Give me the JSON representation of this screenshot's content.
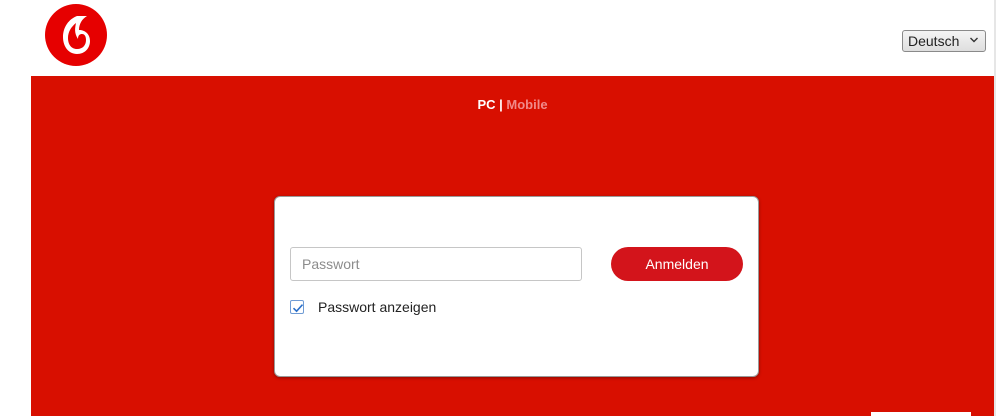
{
  "header": {
    "logo_icon": "vodafone-speechmark-logo",
    "language_select": {
      "selected": "Deutsch",
      "icon": "chevron-down-icon"
    }
  },
  "mode_switch": {
    "pc_label": "PC",
    "separator": "|",
    "mobile_label": "Mobile"
  },
  "login": {
    "password_placeholder": "Passwort",
    "password_value": "",
    "submit_label": "Anmelden",
    "show_password_label": "Passwort anzeigen",
    "show_password_checked": true
  },
  "colors": {
    "brand_red": "#d80f00",
    "button_red": "#d3141b",
    "mobile_link": "#f08a8a"
  }
}
